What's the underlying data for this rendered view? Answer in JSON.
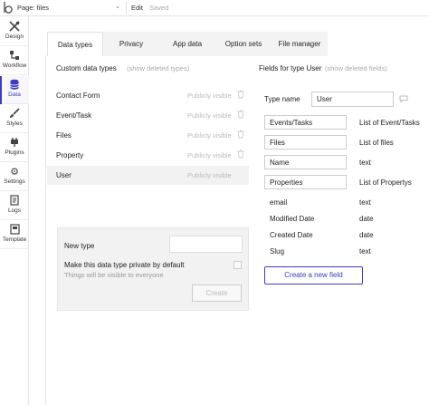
{
  "topbar": {
    "page_label": "Page: files",
    "edit_label": "Edit",
    "saved_label": "Saved"
  },
  "sidebar": {
    "items": [
      {
        "label": "Design",
        "icon": "design-icon"
      },
      {
        "label": "Workflow",
        "icon": "workflow-icon"
      },
      {
        "label": "Data",
        "icon": "database-icon",
        "active": true
      },
      {
        "label": "Styles",
        "icon": "brush-icon"
      },
      {
        "label": "Plugins",
        "icon": "plugin-icon"
      },
      {
        "label": "Settings",
        "icon": "gear-icon"
      },
      {
        "label": "Logs",
        "icon": "logs-icon"
      },
      {
        "label": "Template",
        "icon": "template-icon"
      }
    ]
  },
  "tabs": [
    "Data types",
    "Privacy",
    "App data",
    "Option sets",
    "File manager"
  ],
  "data_types": {
    "header": "Custom data types",
    "show_deleted": "(show deleted types)",
    "items": [
      {
        "name": "Contact Form",
        "visibility": "Publicly visible"
      },
      {
        "name": "Event/Task",
        "visibility": "Publicly visible"
      },
      {
        "name": "Files",
        "visibility": "Publicly visible"
      },
      {
        "name": "Property",
        "visibility": "Publicly visible"
      },
      {
        "name": "User",
        "visibility": "Publicly visible",
        "selected": true
      }
    ],
    "new_type_label": "New type",
    "new_type_value": "",
    "private_label": "Make this data type private by default",
    "private_sub": "Things will be visible to everyone",
    "create_label": "Create"
  },
  "fields": {
    "header": "Fields for type User",
    "show_deleted": "(show deleted fields)",
    "type_name_label": "Type name",
    "type_name_value": "User",
    "items": [
      {
        "name": "Events/Tasks",
        "type": "List of Event/Tasks",
        "editable": true
      },
      {
        "name": "Files",
        "type": "List of files",
        "editable": true
      },
      {
        "name": "Name",
        "type": "text",
        "editable": true
      },
      {
        "name": "Properties",
        "type": "List of Propertys",
        "editable": true
      },
      {
        "name": "email",
        "type": "text",
        "editable": false
      },
      {
        "name": "Modified Date",
        "type": "date",
        "editable": false
      },
      {
        "name": "Created Date",
        "type": "date",
        "editable": false
      },
      {
        "name": "Slug",
        "type": "text",
        "editable": false
      }
    ],
    "create_field_label": "Create a new field"
  },
  "colors": {
    "accent": "#3b3bbf",
    "muted": "#bbbbbb",
    "panel_bg": "#f2f2f2"
  }
}
